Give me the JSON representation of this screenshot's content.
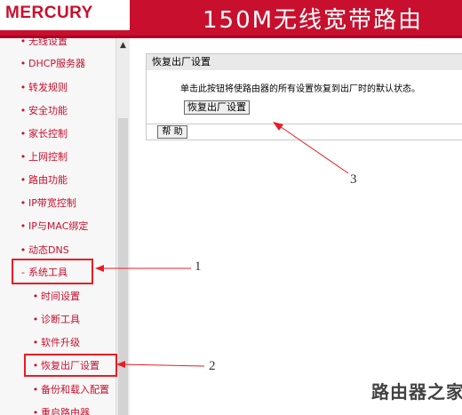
{
  "header": {
    "logo": "MERCURY",
    "title": "150M无线宽带路由"
  },
  "sidebar": {
    "items": [
      {
        "label": "无线设置",
        "bullet": "•"
      },
      {
        "label": "DHCP服务器",
        "bullet": "•"
      },
      {
        "label": "转发规则",
        "bullet": "•"
      },
      {
        "label": "安全功能",
        "bullet": "•"
      },
      {
        "label": "家长控制",
        "bullet": "•"
      },
      {
        "label": "上网控制",
        "bullet": "•"
      },
      {
        "label": "路由功能",
        "bullet": "•"
      },
      {
        "label": "IP带宽控制",
        "bullet": "•"
      },
      {
        "label": "IP与MAC绑定",
        "bullet": "•"
      },
      {
        "label": "动态DNS",
        "bullet": "•"
      },
      {
        "label": "系统工具",
        "bullet": "-"
      }
    ],
    "sub_items": [
      {
        "label": "时间设置",
        "bullet": "•"
      },
      {
        "label": "诊断工具",
        "bullet": "•"
      },
      {
        "label": "软件升级",
        "bullet": "•"
      },
      {
        "label": "恢复出厂设置",
        "bullet": "•"
      },
      {
        "label": "备份和载入配置",
        "bullet": "•"
      },
      {
        "label": "重启路由器",
        "bullet": "•"
      }
    ],
    "scroll_up_glyph": "▲"
  },
  "panel": {
    "title": "恢复出厂设置",
    "description": "单击此按钮将使路由器的所有设置恢复到出厂时的默认状态。",
    "reset_button": "恢复出厂设置",
    "help_button": "帮 助"
  },
  "annotations": {
    "n1": "1",
    "n2": "2",
    "n3": "3"
  },
  "watermark": "路由器之家",
  "colors": {
    "brand_red": "#c8102e",
    "annotation_red": "#e81c24"
  }
}
